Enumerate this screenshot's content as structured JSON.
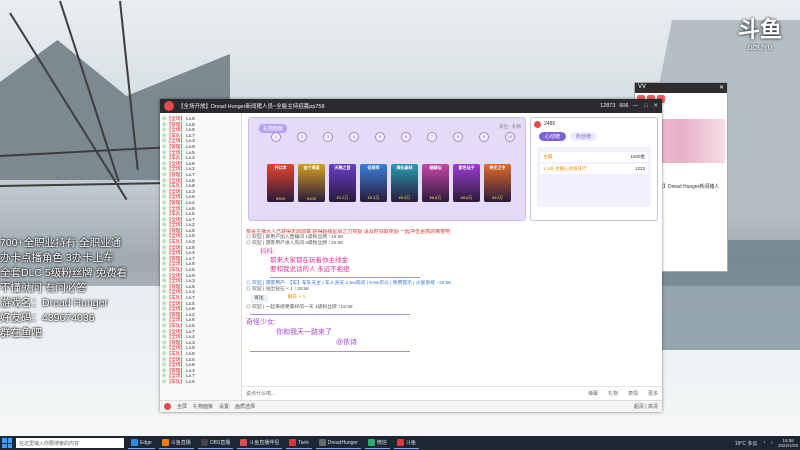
{
  "overlay": {
    "lines": [
      "700+全职业持有 全职业通",
      "办卡点播角色   3办卡上车",
      "全套DLC 5级粉丝牌 免费看",
      "不懂就问 有问必答",
      "游戏名：Dread Hunger",
      "好友码：439674036",
      "群在鱼吧"
    ]
  },
  "logo": {
    "mark": "斗鱼",
    "sub": "DOUYU"
  },
  "window": {
    "title": "【全场开放】Dread Hunger新闻猪人员~全能主持招募pp758",
    "viewers": "12873",
    "fans": "606",
    "controls": [
      "—",
      "□",
      "✕"
    ]
  },
  "side_window": {
    "title": "VV",
    "label": "【全场开放】Dread Hunger新闻猪人员"
  },
  "sidebar_list": [
    {
      "a": "❀",
      "b": "【全场】",
      "c": "Lv.5"
    },
    {
      "a": "❀",
      "b": "【管理】",
      "c": "Lv.8"
    },
    {
      "a": "❀",
      "b": "【全场】",
      "c": "Lv.6"
    },
    {
      "a": "❀",
      "b": "【车队】",
      "c": "Lv.7"
    },
    {
      "a": "❀",
      "b": "【全场】",
      "c": "Lv.3"
    },
    {
      "a": "❀",
      "b": "【管理】",
      "c": "Lv.9"
    },
    {
      "a": "❀",
      "b": "【全场】",
      "c": "Lv.5"
    },
    {
      "a": "❀",
      "b": "【车队】",
      "c": "Lv.4"
    },
    {
      "a": "❀",
      "b": "【全场】",
      "c": "Lv.6"
    },
    {
      "a": "❀",
      "b": "【全场】",
      "c": "Lv.2"
    },
    {
      "a": "❀",
      "b": "【管理】",
      "c": "Lv.7"
    },
    {
      "a": "❀",
      "b": "【全场】",
      "c": "Lv.5"
    },
    {
      "a": "❀",
      "b": "【车队】",
      "c": "Lv.8"
    },
    {
      "a": "❀",
      "b": "【全场】",
      "c": "Lv.3"
    },
    {
      "a": "❀",
      "b": "【全场】",
      "c": "Lv.6"
    },
    {
      "a": "❀",
      "b": "【管理】",
      "c": "Lv.4"
    },
    {
      "a": "❀",
      "b": "【全场】",
      "c": "Lv.9"
    },
    {
      "a": "❀",
      "b": "【车队】",
      "c": "Lv.5"
    },
    {
      "a": "❀",
      "b": "【全场】",
      "c": "Lv.7"
    },
    {
      "a": "❀",
      "b": "【全场】",
      "c": "Lv.2"
    },
    {
      "a": "❀",
      "b": "【管理】",
      "c": "Lv.6"
    },
    {
      "a": "❀",
      "b": "【全场】",
      "c": "Lv.5"
    },
    {
      "a": "❀",
      "b": "【车队】",
      "c": "Lv.3"
    },
    {
      "a": "❀",
      "b": "【全场】",
      "c": "Lv.8"
    },
    {
      "a": "❀",
      "b": "【全场】",
      "c": "Lv.4"
    },
    {
      "a": "❀",
      "b": "【管理】",
      "c": "Lv.7"
    },
    {
      "a": "❀",
      "b": "【全场】",
      "c": "Lv.6"
    },
    {
      "a": "❀",
      "b": "【车队】",
      "c": "Lv.5"
    },
    {
      "a": "❀",
      "b": "【全场】",
      "c": "Lv.9"
    },
    {
      "a": "❀",
      "b": "【全场】",
      "c": "Lv.3"
    },
    {
      "a": "❀",
      "b": "【管理】",
      "c": "Lv.6"
    },
    {
      "a": "❀",
      "b": "【全场】",
      "c": "Lv.4"
    },
    {
      "a": "❀",
      "b": "【车队】",
      "c": "Lv.7"
    },
    {
      "a": "❀",
      "b": "【全场】",
      "c": "Lv.5"
    },
    {
      "a": "❀",
      "b": "【全场】",
      "c": "Lv.8"
    },
    {
      "a": "❀",
      "b": "【管理】",
      "c": "Lv.2"
    },
    {
      "a": "❀",
      "b": "【全场】",
      "c": "Lv.6"
    },
    {
      "a": "❀",
      "b": "【车队】",
      "c": "Lv.5"
    },
    {
      "a": "❀",
      "b": "【全场】",
      "c": "Lv.7"
    },
    {
      "a": "❀",
      "b": "【全场】",
      "c": "Lv.4"
    },
    {
      "a": "❀",
      "b": "【管理】",
      "c": "Lv.3"
    },
    {
      "a": "❀",
      "b": "【全场】",
      "c": "Lv.9"
    },
    {
      "a": "❀",
      "b": "【车队】",
      "c": "Lv.6"
    },
    {
      "a": "❀",
      "b": "【全场】",
      "c": "Lv.5"
    },
    {
      "a": "❀",
      "b": "【全场】",
      "c": "Lv.8"
    },
    {
      "a": "❀",
      "b": "【管理】",
      "c": "Lv.4"
    },
    {
      "a": "❀",
      "b": "【全场】",
      "c": "Lv.7"
    },
    {
      "a": "❀",
      "b": "【车队】",
      "c": "Lv.5"
    }
  ],
  "gift_panel": {
    "tab": "礼物面板",
    "meta": "背包 · 礼物",
    "dots": [
      "1",
      "2",
      "3",
      "4",
      "5",
      "6",
      "7",
      "8",
      "9",
      "10"
    ],
    "cards": [
      {
        "label": "开口字",
        "price": "¥300",
        "color": "#e2452d"
      },
      {
        "label": "金个鸡蛋",
        "price": "¥100",
        "color": "#d2a021"
      },
      {
        "label": "天稀之音",
        "price": "¥1.2万",
        "color": "#6840c9"
      },
      {
        "label": "召唤师",
        "price": "¥2.3万",
        "color": "#3b7fd8"
      },
      {
        "label": "绿化森林",
        "price": "¥5.9万",
        "color": "#2a9bb3"
      },
      {
        "label": "蝴蝶仙",
        "price": "¥6.8万",
        "color": "#c647a8"
      },
      {
        "label": "紫色仙子",
        "price": "¥8.8万",
        "color": "#9d3bd6"
      },
      {
        "label": "神王之令",
        "price": "¥10万",
        "color": "#e06a2b"
      }
    ]
  },
  "chat_panel": {
    "user": "2486",
    "tabs": [
      "心动榜",
      "粉丝榜"
    ],
    "rows": [
      {
        "name": "主播",
        "value": "1600金"
      },
      {
        "name": "1 1号 主播心动值排行",
        "value": "1223"
      }
    ]
  },
  "feed": {
    "red_banner": "恭喜主播大人已获得天启勋章 获得超级星辰之力奖励 请及时领取奖励 一起冲击更高的荣誉吧",
    "items": [
      "◎ 欢迎 | 新用户加入直播间 1级粉丝牌 ↑15:58",
      "◎ 欢迎 | 游客用户进入房间 2级粉丝牌 ↑15:58"
    ],
    "pink_title": "抖抖:",
    "pink_lines": [
      "那来大家都在玩着你主线金",
      "要和我说话的人 永远不拒绝"
    ],
    "notice": "◎ 欢迎 | 游客用户: 【车】车队天主 | 车人员天 1.6w房间 | 9.6w可以 | 免费提示 | 火星系统 ↑15:58",
    "gift_line": "◎ 欢迎 | 送出钻石 × 1 ↑15:58",
    "gift_tag": "寄送",
    "gift_text": "鲜花 × 1",
    "emoji_line": "◎ 欢迎 | 一起来感受美好的一天 1级粉丝牌 ↑15:58",
    "purple_title": "奇怪少女:",
    "purple_line": "你和我天一路来了",
    "at_user": "@依诗"
  },
  "input": {
    "placeholder": "说点什么吧...",
    "buttons": [
      "弹幕",
      "礼物",
      "表情",
      "更多"
    ]
  },
  "statusbar": {
    "items": [
      "全屏",
      "礼物面板",
      "设置",
      "画质选择"
    ],
    "right": "超清 | 高清"
  },
  "taskbar": {
    "search_placeholder": "在这里输入你要搜索的内容",
    "apps": [
      {
        "name": "Edge",
        "color": "#2b8de0"
      },
      {
        "name": "斗鱼直播",
        "color": "#ff7a00"
      },
      {
        "name": "OBS直播",
        "color": "#444444"
      },
      {
        "name": "斗鱼直播伴侣",
        "color": "#e14b4b"
      },
      {
        "name": "Tank",
        "color": "#d83b3b"
      },
      {
        "name": "DreadHunger",
        "color": "#6a6a6a"
      },
      {
        "name": "微信",
        "color": "#2aae67"
      },
      {
        "name": "斗鱼",
        "color": "#d83b3b"
      }
    ],
    "weather": "19°C 多云",
    "time": "15:58",
    "date": "2022/4/29"
  }
}
